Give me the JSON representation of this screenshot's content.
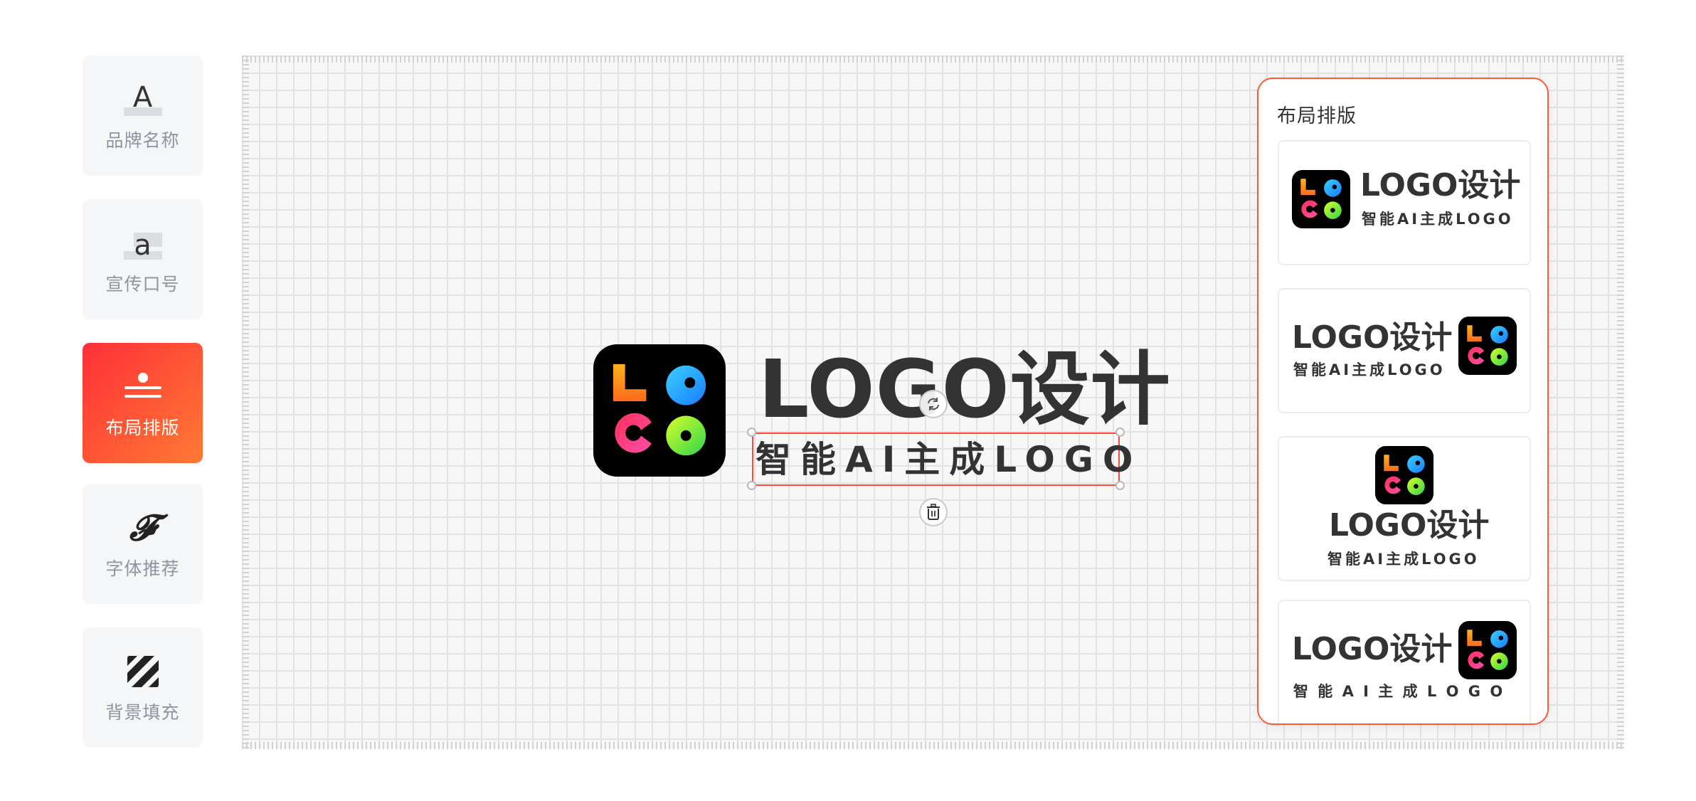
{
  "toolbar": {
    "items": [
      {
        "label": "品牌名称",
        "glyph": "A",
        "icon": "brand-name-icon"
      },
      {
        "label": "宣传口号",
        "glyph": "a",
        "icon": "slogan-icon"
      },
      {
        "label": "布局排版",
        "icon": "layout-icon",
        "active": true
      },
      {
        "label": "字体推荐",
        "glyph": "𝓕",
        "icon": "font-icon"
      },
      {
        "label": "背景填充",
        "icon": "background-fill-icon"
      }
    ]
  },
  "canvas": {
    "brand_name": "LOGO设计",
    "slogan": "智能AI主成LOGO",
    "icon_letters": "LOGO",
    "rotate_icon": "rotate-icon",
    "delete_icon": "trash-icon"
  },
  "panel": {
    "title": "布局排版",
    "options": [
      {
        "brand_name": "LOGO设计",
        "slogan": "智能AI主成LOGO",
        "arrangement": "icon-left"
      },
      {
        "brand_name": "LOGO设计",
        "slogan": "智能AI主成LOGO",
        "arrangement": "icon-right"
      },
      {
        "brand_name": "LOGO设计",
        "slogan": "智能AI主成LOGO",
        "arrangement": "icon-top"
      },
      {
        "brand_name": "LOGO设计",
        "slogan": "智 能 A I 主 成 L O G O",
        "arrangement": "icon-right-wide-slogan"
      }
    ]
  },
  "colors": {
    "accent_gradient_start": "#ff2f38",
    "accent_gradient_end": "#ff7a33",
    "panel_border": "#ff5a36",
    "selection_border": "#ff4a3b",
    "text_dark": "#333333",
    "tool_label": "#8d95a1"
  }
}
